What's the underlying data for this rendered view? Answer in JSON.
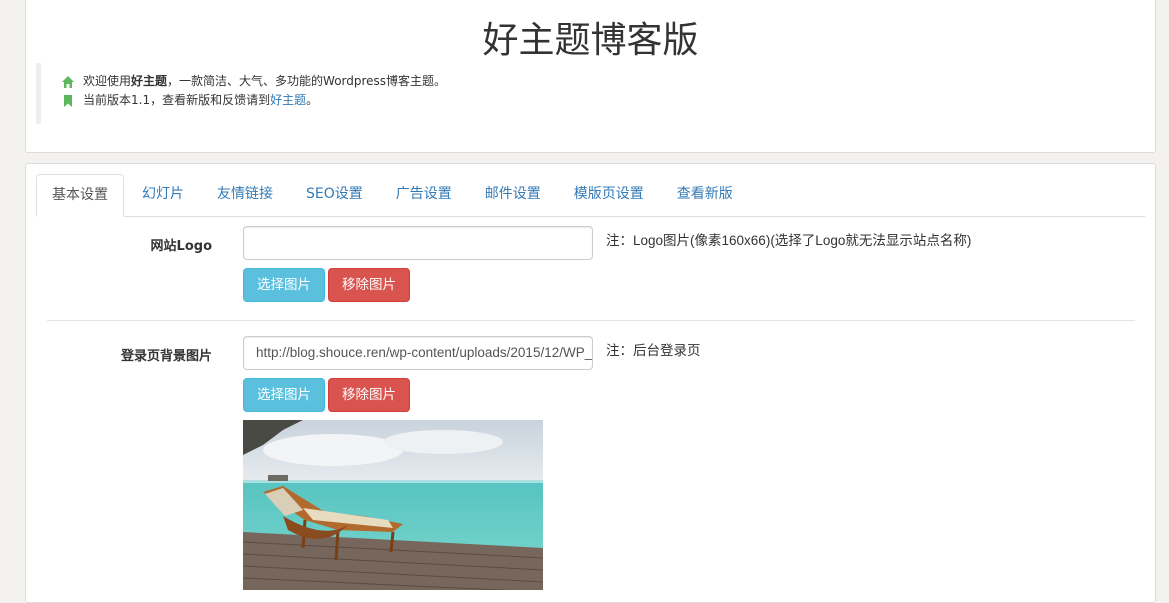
{
  "header": {
    "title": "好主题博客版",
    "line1_prefix": "欢迎使用",
    "line1_bold": "好主题",
    "line1_suffix": "，一款简洁、大气、多功能的Wordpress博客主题。",
    "line2_prefix": "当前版本1.1，查看新版和反馈请到",
    "line2_link": "好主题",
    "line2_suffix": "。",
    "icon_color": "#5cb85c"
  },
  "tabs": [
    {
      "label": "基本设置",
      "active": true
    },
    {
      "label": "幻灯片"
    },
    {
      "label": "友情链接"
    },
    {
      "label": "SEO设置"
    },
    {
      "label": "广告设置"
    },
    {
      "label": "邮件设置"
    },
    {
      "label": "模版页设置"
    },
    {
      "label": "查看新版"
    }
  ],
  "logo_field": {
    "label": "网站Logo",
    "value": "",
    "note": "注：Logo图片(像素160x66)(选择了Logo就无法显示站点名称)",
    "select_button": "选择图片",
    "remove_button": "移除图片"
  },
  "login_bg_field": {
    "label": "登录页背景图片",
    "value": "http://blog.shouce.ren/wp-content/uploads/2015/12/WP_",
    "note": "注：后台登录页",
    "select_button": "选择图片",
    "remove_button": "移除图片"
  },
  "colors": {
    "link": "#337ab7",
    "info": "#5bc0de",
    "danger": "#d9534f"
  }
}
